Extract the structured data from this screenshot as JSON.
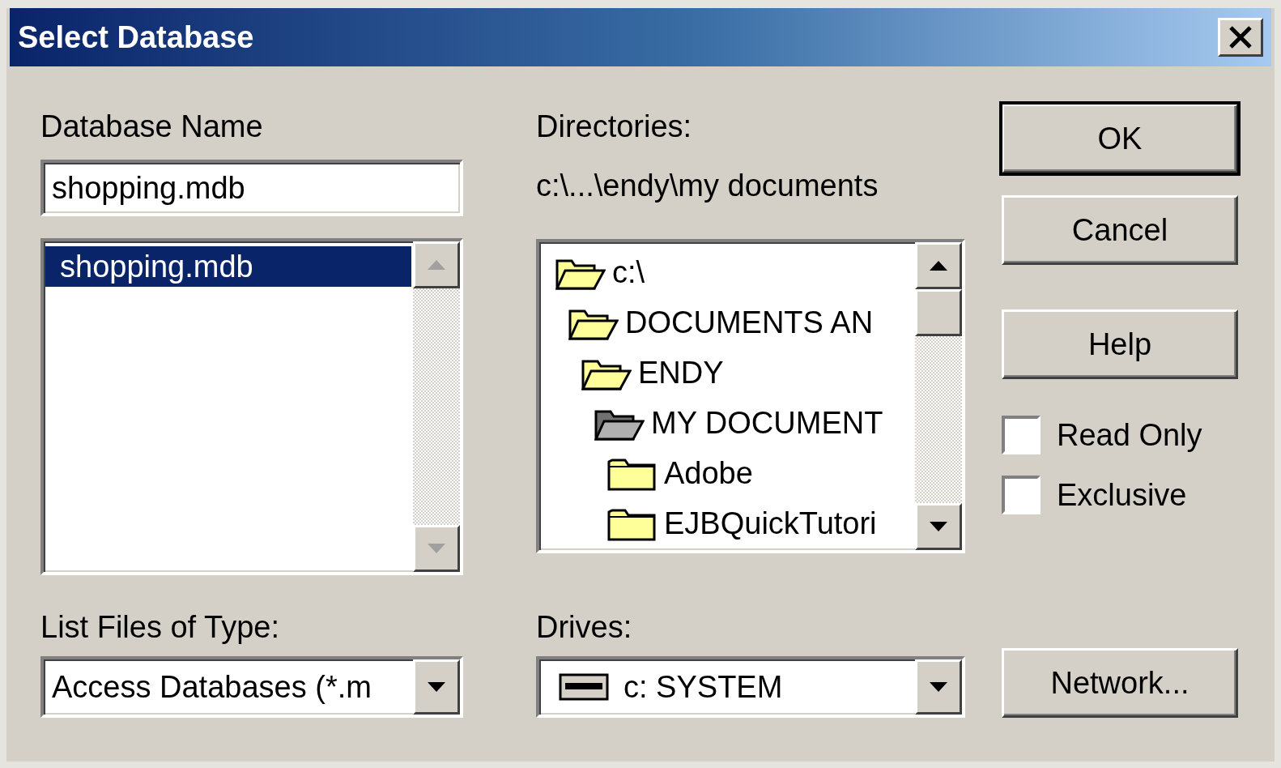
{
  "window": {
    "title": "Select Database"
  },
  "database_name": {
    "label": "Database Name",
    "value": "shopping.mdb"
  },
  "files": [
    {
      "label": "shopping.mdb",
      "selected": true
    }
  ],
  "directories": {
    "label": "Directories:",
    "path": "c:\\...\\endy\\my documents",
    "tree": [
      {
        "label": "c:\\",
        "expanded": true,
        "selected": false,
        "children": [
          {
            "label": "DOCUMENTS AN",
            "expanded": true,
            "selected": false,
            "children": [
              {
                "label": "ENDY",
                "expanded": true,
                "selected": false,
                "children": [
                  {
                    "label": "MY DOCUMENT",
                    "expanded": true,
                    "selected": true,
                    "children": [
                      {
                        "label": "Adobe",
                        "expanded": false,
                        "selected": false
                      },
                      {
                        "label": "EJBQuickTutori",
                        "expanded": false,
                        "selected": false
                      }
                    ]
                  }
                ]
              }
            ]
          }
        ]
      }
    ]
  },
  "file_type": {
    "label": "List Files of Type:",
    "value": "Access Databases (*.m"
  },
  "drives": {
    "label": "Drives:",
    "value": "c: SYSTEM"
  },
  "buttons": [
    {
      "label": "OK",
      "default": true
    },
    {
      "label": "Cancel",
      "default": false
    },
    {
      "label": "Help",
      "default": false
    }
  ],
  "options": [
    {
      "label": "Read Only",
      "checked": false
    },
    {
      "label": "Exclusive",
      "checked": false
    }
  ],
  "network_button": {
    "label": "Network..."
  }
}
